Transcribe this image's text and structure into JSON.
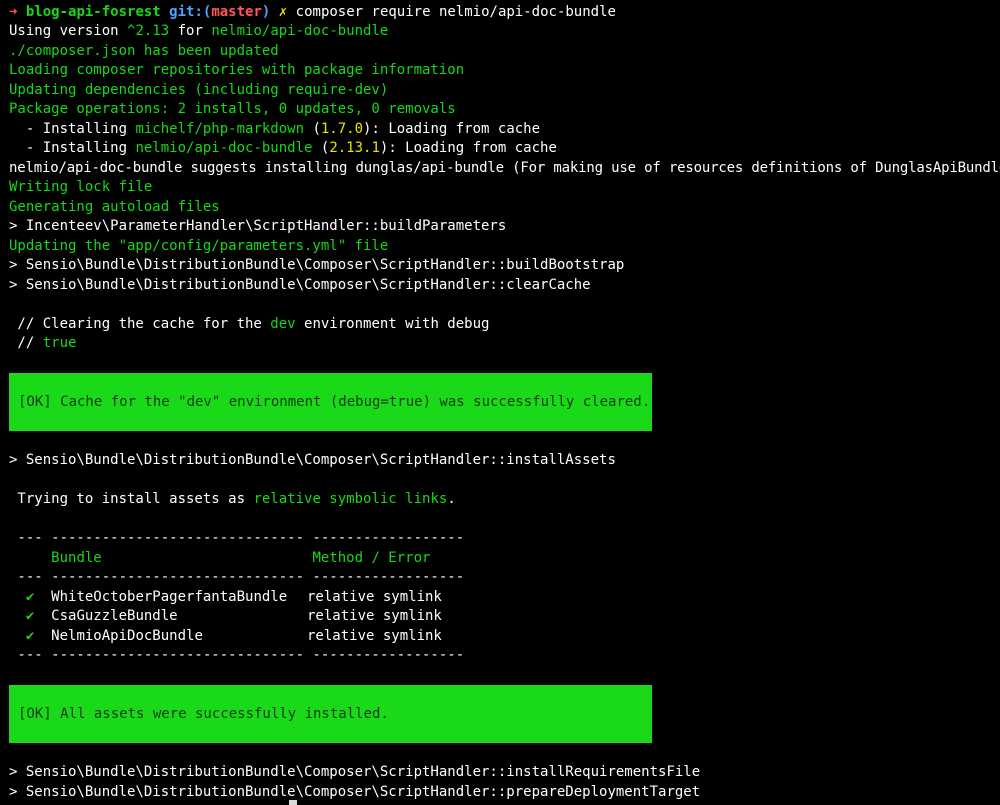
{
  "prompt": {
    "arrow": "➜",
    "directory": "blog-api-fosrest",
    "git_label": "git:(",
    "branch": "master",
    "git_close": ")",
    "dirty": "✗",
    "command": "composer require nelmio/api-doc-bundle"
  },
  "version_line": {
    "prefix": "Using version ",
    "version": "^2.13",
    "middle": " for ",
    "package": "nelmio/api-doc-bundle"
  },
  "status_lines": {
    "composer_updated": "./composer.json has been updated",
    "loading_repos": "Loading composer repositories with package information",
    "updating_deps": "Updating dependencies (including require-dev)",
    "package_ops": "Package operations: 2 installs, 0 updates, 0 removals"
  },
  "installs": [
    {
      "prefix": "  - Installing ",
      "package": "michelf/php-markdown",
      "open": " (",
      "version": "1.7.0",
      "close": "): Loading from cache"
    },
    {
      "prefix": "  - Installing ",
      "package": "nelmio/api-doc-bundle",
      "open": " (",
      "version": "2.13.1",
      "close": "): Loading from cache"
    }
  ],
  "suggest_line": "nelmio/api-doc-bundle suggests installing dunglas/api-bundle (For making use of resources definitions of DunglasApiBundle.)",
  "writing_lock": "Writing lock file",
  "generating_autoload": "Generating autoload files",
  "script_build_params": "> Incenteev\\ParameterHandler\\ScriptHandler::buildParameters",
  "updating_params": "Updating the \"app/config/parameters.yml\" file",
  "script_build_bootstrap": "> Sensio\\Bundle\\DistributionBundle\\Composer\\ScriptHandler::buildBootstrap",
  "script_clear_cache": "> Sensio\\Bundle\\DistributionBundle\\Composer\\ScriptHandler::clearCache",
  "clearing": {
    "l1_prefix": " // Clearing the cache for the ",
    "env": "dev",
    "l1_suffix": " environment with debug",
    "l2_prefix": " // ",
    "debug": "true"
  },
  "ok_cache": "[OK] Cache for the \"dev\" environment (debug=true) was successfully cleared.",
  "script_install_assets": "> Sensio\\Bundle\\DistributionBundle\\Composer\\ScriptHandler::installAssets",
  "trying": {
    "prefix": " Trying to install assets as ",
    "mode": "relative symbolic links",
    "suffix": "."
  },
  "table": {
    "rule": " --- ------------------------------ ------------------",
    "header_pad": "     ",
    "col_bundle": "Bundle",
    "header_gap": "                         ",
    "col_method": "Method / Error",
    "check": "✔",
    "rows": [
      {
        "bundle": "WhiteOctoberPagerfantaBundle",
        "method": "relative symlink"
      },
      {
        "bundle": "CsaGuzzleBundle",
        "method": "relative symlink"
      },
      {
        "bundle": "NelmioApiDocBundle",
        "method": "relative symlink"
      }
    ]
  },
  "ok_assets": "[OK] All assets were successfully installed.",
  "script_requirements": "> Sensio\\Bundle\\DistributionBundle\\Composer\\ScriptHandler::installRequirementsFile",
  "script_prepare": "> Sensio\\Bundle\\DistributionBundle\\Composer\\ScriptHandler::prepareDeploymentTarget",
  "colors": {
    "background": "#000000",
    "green": "#16d916",
    "yellow": "#e8e500",
    "red": "#ff5959",
    "ok_box": "#19d919"
  }
}
